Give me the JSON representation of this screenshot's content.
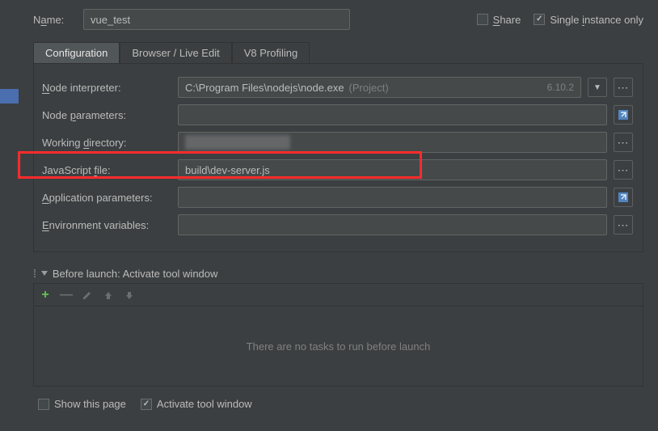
{
  "header": {
    "name_label_pre": "N",
    "name_label_u": "a",
    "name_label_post": "me:",
    "name_value": "vue_test",
    "share_pre": "",
    "share_u": "S",
    "share_post": "hare",
    "single_pre": "Single ",
    "single_u": "i",
    "single_post": "nstance only",
    "share_checked": false,
    "single_checked": true
  },
  "tabs": [
    {
      "label": "Configuration",
      "active": true
    },
    {
      "label": "Browser / Live Edit",
      "active": false
    },
    {
      "label": "V8 Profiling",
      "active": false
    }
  ],
  "config": {
    "node_interpreter": {
      "lbl_pre": "",
      "lbl_u": "N",
      "lbl_post": "ode interpreter:",
      "value": "C:\\Program Files\\nodejs\\node.exe",
      "hint": "(Project)",
      "version": "6.10.2"
    },
    "node_parameters": {
      "lbl_pre": "Node ",
      "lbl_u": "p",
      "lbl_post": "arameters:",
      "value": ""
    },
    "working_directory": {
      "lbl_pre": "Working ",
      "lbl_u": "d",
      "lbl_post": "irectory:",
      "value": ""
    },
    "javascript_file": {
      "lbl_pre": "JavaScript ",
      "lbl_u": "f",
      "lbl_post": "ile:",
      "value": "build\\dev-server.js"
    },
    "app_parameters": {
      "lbl_pre": "",
      "lbl_u": "A",
      "lbl_post": "pplication parameters:",
      "value": ""
    },
    "env_variables": {
      "lbl_pre": "",
      "lbl_u": "E",
      "lbl_post": "nvironment variables:",
      "value": ""
    }
  },
  "before_launch": {
    "header": "Before launch: Activate tool window",
    "empty_text": "There are no tasks to run before launch",
    "show_this_page": {
      "label": "Show this page",
      "checked": false
    },
    "activate_tool_window": {
      "label": "Activate tool window",
      "checked": true
    }
  }
}
